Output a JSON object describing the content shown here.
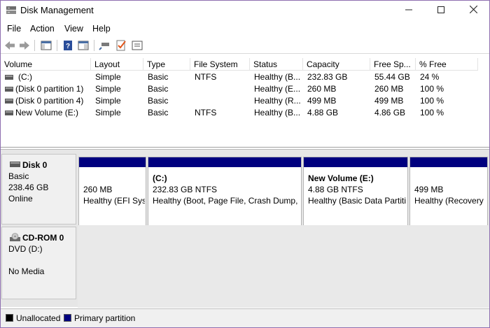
{
  "window": {
    "title": "Disk Management",
    "minimize": "—",
    "maximize": "☐",
    "close": "✕"
  },
  "menu": {
    "file": "File",
    "action": "Action",
    "view": "View",
    "help": "Help"
  },
  "toolbar": {
    "icons": [
      "back-arrow-icon",
      "forward-arrow-icon",
      "console-tree-icon",
      "help-icon",
      "show-pane-icon",
      "connect-icon",
      "check-icon",
      "properties-icon"
    ]
  },
  "table": {
    "columns": [
      "Volume",
      "Layout",
      "Type",
      "File System",
      "Status",
      "Capacity",
      "Free Sp...",
      "% Free"
    ],
    "rows": [
      {
        "volume": "(C:)",
        "layout": "Simple",
        "type": "Basic",
        "fs": "NTFS",
        "status": "Healthy (B...",
        "capacity": "232.83 GB",
        "free": "55.44 GB",
        "pct": "24 %"
      },
      {
        "volume": "(Disk 0 partition 1)",
        "layout": "Simple",
        "type": "Basic",
        "fs": "",
        "status": "Healthy (E...",
        "capacity": "260 MB",
        "free": "260 MB",
        "pct": "100 %"
      },
      {
        "volume": "(Disk 0 partition 4)",
        "layout": "Simple",
        "type": "Basic",
        "fs": "",
        "status": "Healthy (R...",
        "capacity": "499 MB",
        "free": "499 MB",
        "pct": "100 %"
      },
      {
        "volume": "New Volume (E:)",
        "layout": "Simple",
        "type": "Basic",
        "fs": "NTFS",
        "status": "Healthy (B...",
        "capacity": "4.88 GB",
        "free": "4.86 GB",
        "pct": "100 %"
      }
    ]
  },
  "disk0": {
    "name": "Disk 0",
    "type": "Basic",
    "size": "238.46 GB",
    "state": "Online",
    "partitions": [
      {
        "name": "",
        "size": "260 MB",
        "status": "Healthy (EFI Sys"
      },
      {
        "name": "(C:)",
        "size": "232.83 GB NTFS",
        "status": "Healthy (Boot, Page File, Crash Dump, E"
      },
      {
        "name": "New Volume  (E:)",
        "size": "4.88 GB NTFS",
        "status": "Healthy (Basic Data Partiti"
      },
      {
        "name": "",
        "size": "499 MB",
        "status": "Healthy (Recovery"
      }
    ]
  },
  "cdrom": {
    "name": "CD-ROM 0",
    "drive": "DVD (D:)",
    "media": "No Media"
  },
  "legend": {
    "unallocated": {
      "label": "Unallocated",
      "color": "#000000"
    },
    "primary": {
      "label": "Primary partition",
      "color": "#00007f"
    }
  }
}
